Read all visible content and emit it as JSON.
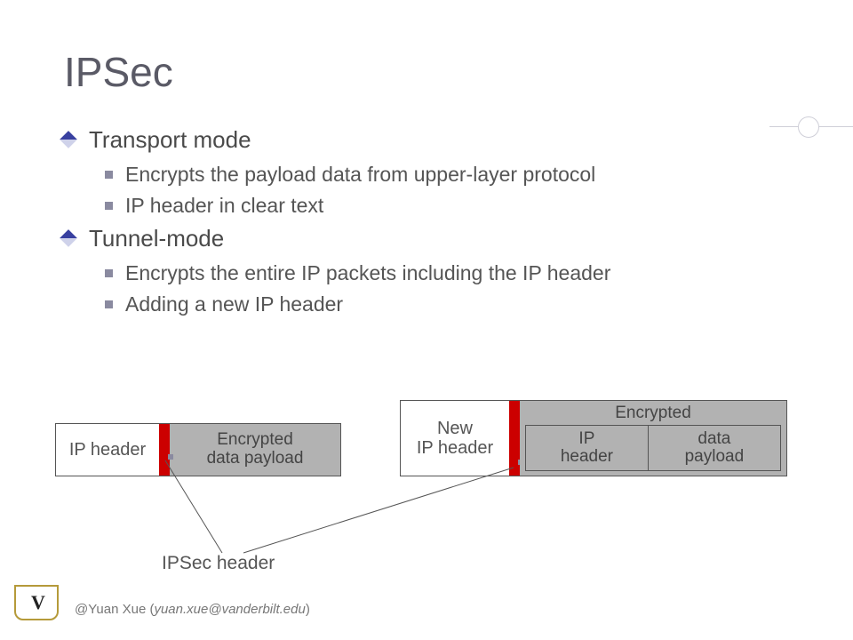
{
  "title": "IPSec",
  "bullets": [
    {
      "level": 1,
      "text": "Transport mode"
    },
    {
      "level": 2,
      "text": "Encrypts the payload data from upper-layer protocol"
    },
    {
      "level": 2,
      "text": "IP header in clear text"
    },
    {
      "level": 1,
      "text": "Tunnel-mode"
    },
    {
      "level": 2,
      "text": "Encrypts the entire IP packets including the IP header"
    },
    {
      "level": 2,
      "text": "Adding a new IP header"
    }
  ],
  "diagram": {
    "transport": {
      "ip_header": "IP header",
      "encrypted_payload": "Encrypted\ndata payload"
    },
    "tunnel": {
      "new_ip_header": "New\nIP header",
      "encrypted_label": "Encrypted",
      "inner_ip_header": "IP\nheader",
      "inner_payload": "data\npayload"
    },
    "ipsec_label": "IPSec header"
  },
  "footer": {
    "name": "@Yuan Xue",
    "email": "yuan.xue@vanderbilt.edu"
  },
  "logo_text": "V"
}
